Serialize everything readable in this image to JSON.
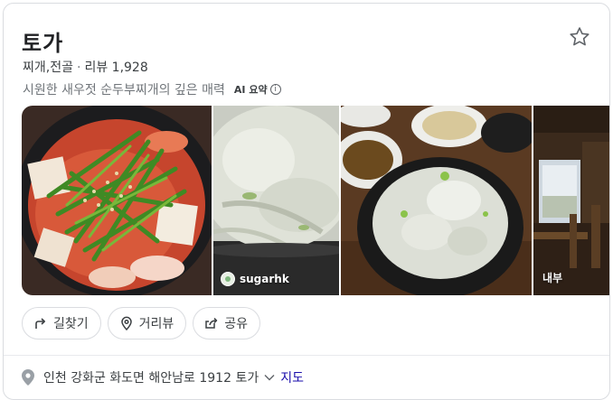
{
  "place": {
    "name": "토가",
    "category": "찌개,전골",
    "review_label": "리뷰",
    "review_count": "1,928",
    "summary": "시원한 새우젓 순두부찌개의 깊은 매력",
    "ai_badge": "AI 요약",
    "info_glyph": "i"
  },
  "photos": {
    "credit_user": "sugarhk",
    "interior_label": "내부"
  },
  "actions": {
    "directions": "길찾기",
    "street_view": "거리뷰",
    "share": "공유"
  },
  "address": {
    "text": "인천 강화군 화도면 해안남로 1912 토가",
    "map_link": "지도"
  },
  "icons": {
    "favorite": "star-outline-icon",
    "directions": "turn-right-arrow-icon",
    "street_view": "location-pin-outline-icon",
    "share": "share-icon",
    "address": "location-pin-icon",
    "expand": "chevron-down-icon"
  },
  "colors": {
    "title": "#202124",
    "secondary_text": "#70757a",
    "link": "#1a0dab",
    "border": "#dadce0"
  }
}
